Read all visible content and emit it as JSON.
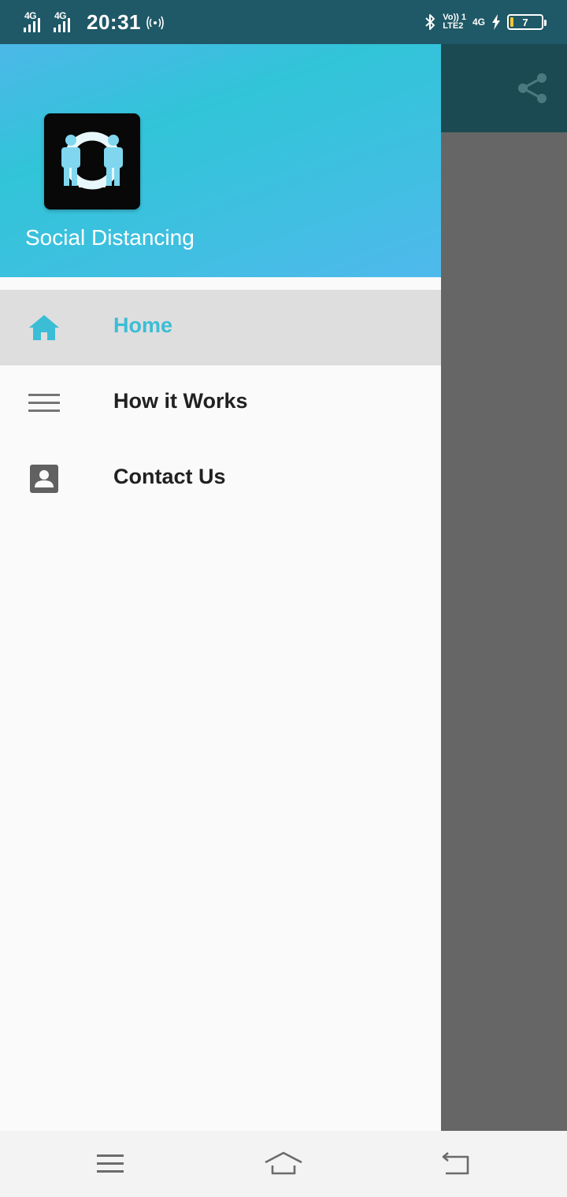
{
  "status_bar": {
    "sim1_network": "4G",
    "sim2_network": "4G",
    "time": "20:31",
    "hotspot_icon": "wifi-calling-icon",
    "bluetooth_icon": "bluetooth-icon",
    "volte_top": "Vo)) 1",
    "volte_bottom": "LTE2",
    "data_network": "4G",
    "charging_icon": "bolt-icon",
    "battery_level": "7"
  },
  "app_toolbar": {
    "share_icon": "share-icon"
  },
  "drawer": {
    "header": {
      "app_name": "Social Distancing",
      "logo_icon": "social-distancing-logo"
    },
    "items": [
      {
        "label": "Home",
        "icon": "home-icon",
        "active": true
      },
      {
        "label": "How it Works",
        "icon": "menu-lines-icon",
        "active": false
      },
      {
        "label": "Contact Us",
        "icon": "contact-card-icon",
        "active": false
      }
    ]
  },
  "colors": {
    "accent": "#3bbdd6",
    "header_gradient_start": "#4cb8e8",
    "header_gradient_mid": "#31c4d8",
    "toolbar": "#1b4a52",
    "scrim": "#666666"
  },
  "nav_bar": {
    "buttons": [
      "menu-icon",
      "home-icon",
      "back-icon"
    ]
  }
}
